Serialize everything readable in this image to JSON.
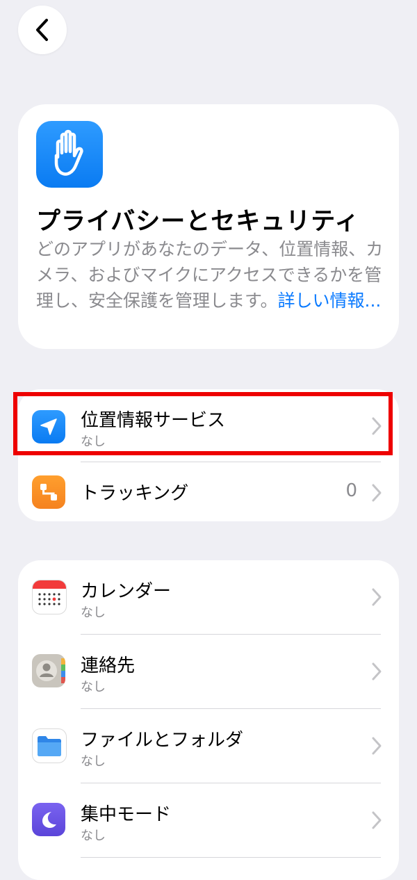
{
  "header": {
    "title": "プライバシーとセキュリティ",
    "description": "どのアプリがあなたのデータ、位置情報、カメラ、およびマイクにアクセスできるかを管理し、安全保護を管理します。",
    "more_link": "詳しい情報..."
  },
  "group1": [
    {
      "title": "位置情報サービス",
      "subtitle": "なし",
      "icon": "location-arrow-icon"
    },
    {
      "title": "トラッキング",
      "value": "0",
      "icon": "tracking-icon"
    }
  ],
  "group2": [
    {
      "title": "カレンダー",
      "subtitle": "なし",
      "icon": "calendar-icon"
    },
    {
      "title": "連絡先",
      "subtitle": "なし",
      "icon": "contacts-icon"
    },
    {
      "title": "ファイルとフォルダ",
      "subtitle": "なし",
      "icon": "folder-icon"
    },
    {
      "title": "集中モード",
      "subtitle": "なし",
      "icon": "moon-icon"
    }
  ],
  "colors": {
    "background": "#EFEFF4",
    "accent": "#0A7AFF",
    "highlight": "#EE0000"
  }
}
